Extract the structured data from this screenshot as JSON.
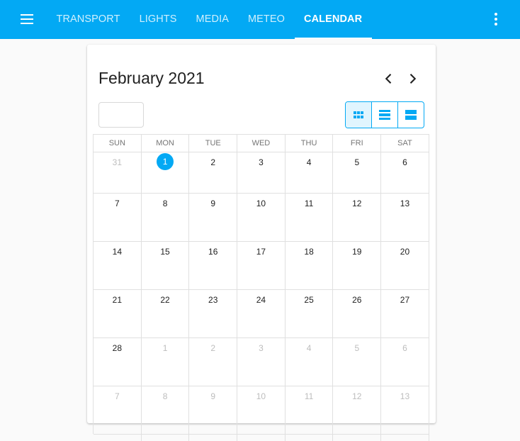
{
  "nav": {
    "tabs": [
      "TRANSPORT",
      "LIGHTS",
      "MEDIA",
      "METEO",
      "CALENDAR"
    ],
    "active_tab": "CALENDAR",
    "menu_icon": "menu-icon",
    "more_icon": "more-vert-icon"
  },
  "calendar": {
    "title": "February 2021",
    "prev_icon": "chevron-left-icon",
    "next_icon": "chevron-right-icon",
    "today_input_value": "",
    "views": [
      {
        "icon": "month-view-icon",
        "selected": true
      },
      {
        "icon": "week-view-icon",
        "selected": false
      },
      {
        "icon": "day-view-icon",
        "selected": false
      }
    ],
    "weekdays": [
      "SUN",
      "MON",
      "TUE",
      "WED",
      "THU",
      "FRI",
      "SAT"
    ],
    "weeks": [
      [
        "31",
        "1",
        "2",
        "3",
        "4",
        "5",
        "6"
      ],
      [
        "7",
        "8",
        "9",
        "10",
        "11",
        "12",
        "13"
      ],
      [
        "14",
        "15",
        "16",
        "17",
        "18",
        "19",
        "20"
      ],
      [
        "21",
        "22",
        "23",
        "24",
        "25",
        "26",
        "27"
      ],
      [
        "28",
        "1",
        "2",
        "3",
        "4",
        "5",
        "6"
      ],
      [
        "7",
        "8",
        "9",
        "10",
        "11",
        "12",
        "13"
      ],
      [
        "",
        "",
        "",
        "",
        "",
        "",
        ""
      ]
    ],
    "today": "1",
    "accent_color": "#03a9f4",
    "muted_color": "#bdbdbd"
  }
}
